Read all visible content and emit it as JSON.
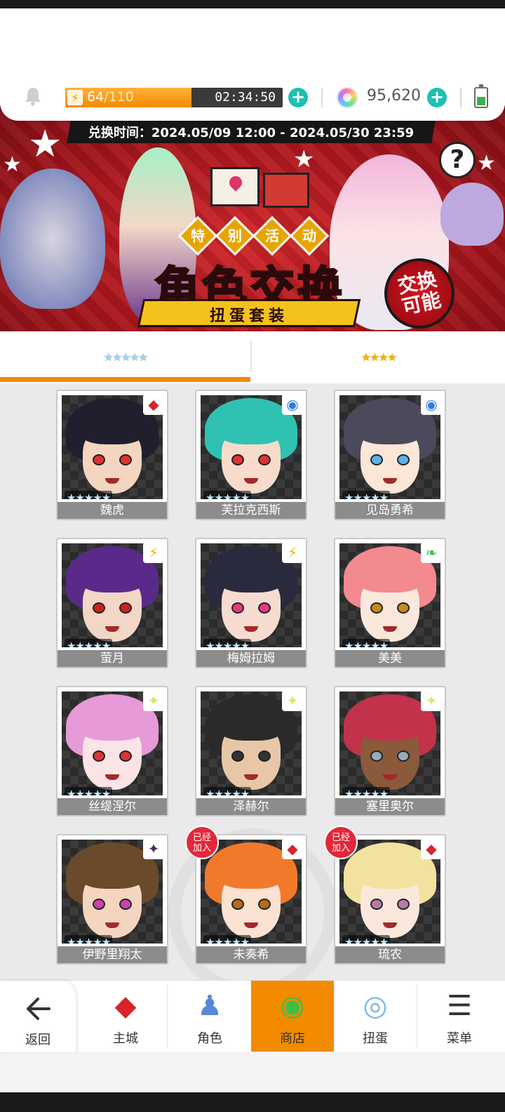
{
  "status": {
    "stamina_current": "64",
    "stamina_max": "/110",
    "stamina_fraction": 0.58,
    "stamina_timer": "02:34:50",
    "gems": "95,620"
  },
  "banner": {
    "exchange_period": "兑换时间：2024.05/09 12:00 - 2024.05/30 23:59",
    "subtitle_chars": [
      "特",
      "别",
      "活",
      "动"
    ],
    "title": "角色交换",
    "ribbon": "扭蛋套装",
    "badge_line1": "交换",
    "badge_line2": "可能",
    "help": "?"
  },
  "tabs": [
    {
      "label": "★★★★★",
      "active": true
    },
    {
      "label": "★★★★",
      "active": false
    }
  ],
  "characters": [
    {
      "name": "魏虎",
      "stars": "★★★★★",
      "attribute": "fire-diamond-icon",
      "attr_glyph": "◆",
      "attr_class": "attr-red",
      "joined": false,
      "hair": "#1f1f2e",
      "skin": "#f4d5c0",
      "eye": "#d33"
    },
    {
      "name": "芙拉克西斯",
      "stars": "★★★★★",
      "attribute": "water-circle-icon",
      "attr_glyph": "◉",
      "attr_class": "attr-blue",
      "joined": false,
      "hair": "#2fc2b2",
      "skin": "#f7dccb",
      "eye": "#d33"
    },
    {
      "name": "见岛勇希",
      "stars": "★★★★★",
      "attribute": "water-circle-icon",
      "attr_glyph": "◉",
      "attr_class": "attr-blue",
      "joined": false,
      "hair": "#4a4a5c",
      "skin": "#fbe6d8",
      "eye": "#5ab2e8"
    },
    {
      "name": "萤月",
      "stars": "★★★★★",
      "attribute": "thunder-bolt-icon",
      "attr_glyph": "⚡",
      "attr_class": "attr-yellow",
      "joined": false,
      "hair": "#5a2a8a",
      "skin": "#f2d6c6",
      "eye": "#c22"
    },
    {
      "name": "梅姆拉姆",
      "stars": "★★★★★",
      "attribute": "thunder-bolt-icon",
      "attr_glyph": "⚡",
      "attr_class": "attr-yellow",
      "joined": false,
      "hair": "#2a2a3e",
      "skin": "#f6dcd0",
      "eye": "#e33a7a"
    },
    {
      "name": "美美",
      "stars": "★★★★★",
      "attribute": "leaf-icon",
      "attr_glyph": "❧",
      "attr_class": "attr-green",
      "joined": false,
      "hair": "#f28a90",
      "skin": "#fbe8dc",
      "eye": "#c8891a"
    },
    {
      "name": "丝缇涅尔",
      "stars": "★★★★★",
      "attribute": "light-sparkle-icon",
      "attr_glyph": "✦",
      "attr_class": "attr-light",
      "joined": false,
      "hair": "#e79ad8",
      "skin": "#fbe4e6",
      "eye": "#d33"
    },
    {
      "name": "泽赫尔",
      "stars": "★★★★★",
      "attribute": "light-sparkle-icon",
      "attr_glyph": "✦",
      "attr_class": "attr-light",
      "joined": false,
      "hair": "#2a2a2a",
      "skin": "#e8c7a8",
      "eye": "#333"
    },
    {
      "name": "塞里奥尔",
      "stars": "★★★★★",
      "attribute": "light-sparkle-icon",
      "attr_glyph": "✦",
      "attr_class": "attr-light",
      "joined": false,
      "hair": "#c2324a",
      "skin": "#8a5a3a",
      "eye": "#9ab"
    },
    {
      "name": "伊野里翔太",
      "stars": "★★★★★",
      "attribute": "dark-sparkle-icon",
      "attr_glyph": "✦",
      "attr_class": "attr-dark",
      "joined": false,
      "hair": "#6a4a2a",
      "skin": "#f4d6c0",
      "eye": "#c4a"
    },
    {
      "name": "未奏希",
      "stars": "★★★★★",
      "attribute": "fire-diamond-icon",
      "attr_glyph": "◆",
      "attr_class": "attr-red",
      "joined": true,
      "hair": "#f07a2a",
      "skin": "#fbe2d2",
      "eye": "#b86a1a"
    },
    {
      "name": "琉农",
      "stars": "★★★★★",
      "attribute": "fire-diamond-icon",
      "attr_glyph": "◆",
      "attr_class": "attr-red",
      "joined": true,
      "hair": "#f2e2a0",
      "skin": "#fbe8dc",
      "eye": "#b87aa8"
    }
  ],
  "joined_label_1": "已经",
  "joined_label_2": "加入",
  "nav": {
    "back": "返回",
    "items": [
      {
        "label": "主城",
        "icon": "town-icon",
        "glyph": "◆"
      },
      {
        "label": "角色",
        "icon": "character-icon",
        "glyph": "♟"
      },
      {
        "label": "商店",
        "icon": "shop-icon",
        "glyph": "◉"
      },
      {
        "label": "扭蛋",
        "icon": "gacha-icon",
        "glyph": "◎"
      },
      {
        "label": "菜单",
        "icon": "menu-icon",
        "glyph": "☰"
      }
    ],
    "active_index": 2
  }
}
